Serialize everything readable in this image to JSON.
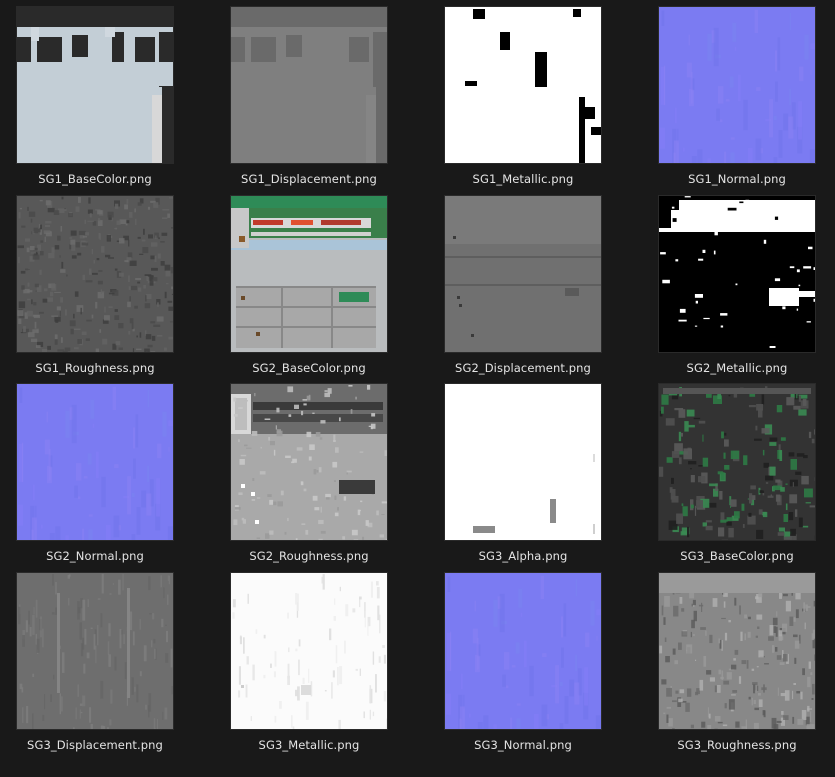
{
  "files": [
    {
      "name": "SG1_BaseColor.png",
      "kind": "basecolor1"
    },
    {
      "name": "SG1_Displacement.png",
      "kind": "disp1"
    },
    {
      "name": "SG1_Metallic.png",
      "kind": "metal1"
    },
    {
      "name": "SG1_Normal.png",
      "kind": "normal"
    },
    {
      "name": "SG1_Roughness.png",
      "kind": "rough1"
    },
    {
      "name": "SG2_BaseColor.png",
      "kind": "basecolor2"
    },
    {
      "name": "SG2_Displacement.png",
      "kind": "disp2"
    },
    {
      "name": "SG2_Metallic.png",
      "kind": "metal2"
    },
    {
      "name": "SG2_Normal.png",
      "kind": "normal"
    },
    {
      "name": "SG2_Roughness.png",
      "kind": "rough2"
    },
    {
      "name": "SG3_Alpha.png",
      "kind": "alpha3"
    },
    {
      "name": "SG3_BaseColor.png",
      "kind": "basecolor3"
    },
    {
      "name": "SG3_Displacement.png",
      "kind": "disp3"
    },
    {
      "name": "SG3_Metallic.png",
      "kind": "metal3"
    },
    {
      "name": "SG3_Normal.png",
      "kind": "normal"
    },
    {
      "name": "SG3_Roughness.png",
      "kind": "rough3"
    }
  ]
}
